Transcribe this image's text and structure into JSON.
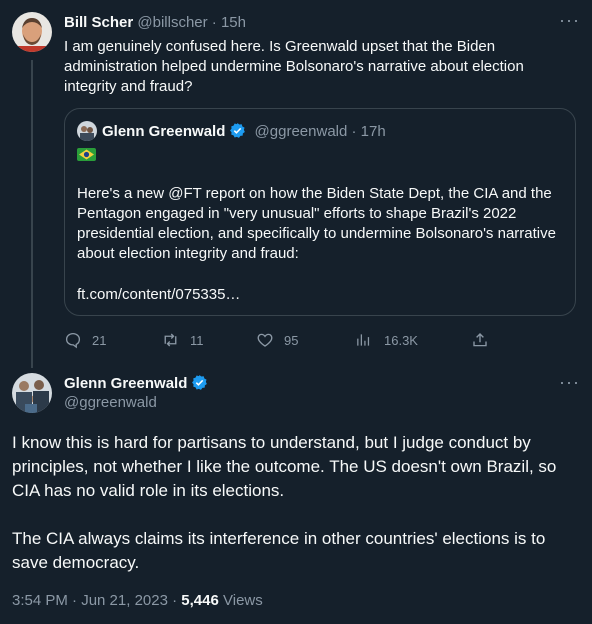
{
  "tweet1": {
    "name": "Bill Scher",
    "handle": "@billscher",
    "time": "· 15h",
    "text": "I am genuinely confused here. Is Greenwald upset that the Biden administration helped undermine Bolsonaro's narrative about election integrity and fraud?",
    "more_icon": "more-icon"
  },
  "quoted": {
    "name": "Glenn Greenwald",
    "handle": "@ggreenwald",
    "time": "· 17h",
    "flag": "🇧🇷",
    "text": "Here's a new @FT report on how the Biden State Dept, the CIA and the Pentagon engaged in \"very unusual\" efforts to shape Brazil's 2022 presidential election, and specifically to undermine Bolsonaro's narrative about election integrity and fraud:",
    "link": "ft.com/content/075335…"
  },
  "actions": {
    "replies": "21",
    "retweets": "11",
    "likes": "95",
    "views": "16.3K"
  },
  "tweet2": {
    "name": "Glenn Greenwald",
    "handle": "@ggreenwald",
    "paragraph1": "I know this is hard for partisans to understand, but I judge conduct by principles, not whether I like the outcome. The US doesn't own Brazil, so CIA has no valid role in its elections.",
    "paragraph2": "The CIA always claims its interference in other countries' elections is to save democracy.",
    "timestamp": "3:54 PM · Jun 21, 2023 ·",
    "views_count": "5,446",
    "views_label": "Views"
  },
  "colors": {
    "background": "#15202b",
    "text": "#f7f9f9",
    "muted": "#8b98a5",
    "border": "#38444d",
    "verified": "#1d9bf0"
  }
}
